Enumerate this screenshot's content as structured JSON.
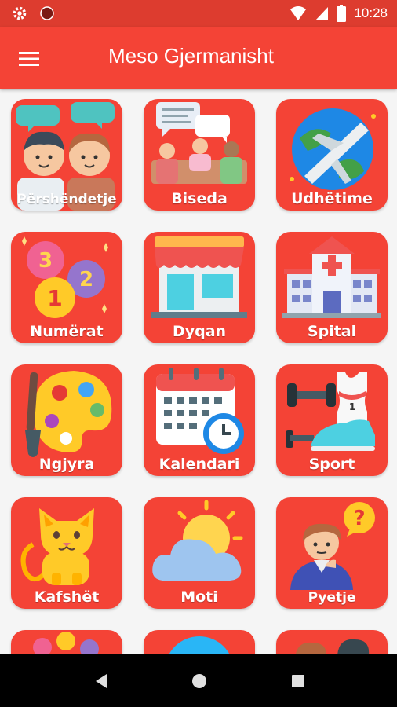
{
  "status_bar": {
    "time": "10:28"
  },
  "app_bar": {
    "title": "Meso Gjermanisht",
    "menu_icon": "hamburger-menu-icon"
  },
  "categories": [
    {
      "label": "Përshëndetje",
      "icon": "greeting-people-icon"
    },
    {
      "label": "Biseda",
      "icon": "conversation-icon"
    },
    {
      "label": "Udhëtime",
      "icon": "airplane-globe-icon"
    },
    {
      "label": "Numërat",
      "icon": "number-balloons-icon"
    },
    {
      "label": "Dyqan",
      "icon": "shop-icon"
    },
    {
      "label": "Spital",
      "icon": "hospital-icon"
    },
    {
      "label": "Ngjyra",
      "icon": "paint-palette-icon"
    },
    {
      "label": "Kalendari",
      "icon": "calendar-clock-icon"
    },
    {
      "label": "Sport",
      "icon": "sport-gear-icon"
    },
    {
      "label": "Kafshët",
      "icon": "cat-icon"
    },
    {
      "label": "Moti",
      "icon": "weather-icon"
    },
    {
      "label": "Pyetje",
      "icon": "question-person-icon"
    }
  ],
  "nav_bar": {
    "back": "back-icon",
    "home": "home-icon",
    "recents": "recents-icon"
  },
  "colors": {
    "primary": "#f44336",
    "status_bar": "#dd3c2f",
    "background": "#f5f5f5"
  }
}
